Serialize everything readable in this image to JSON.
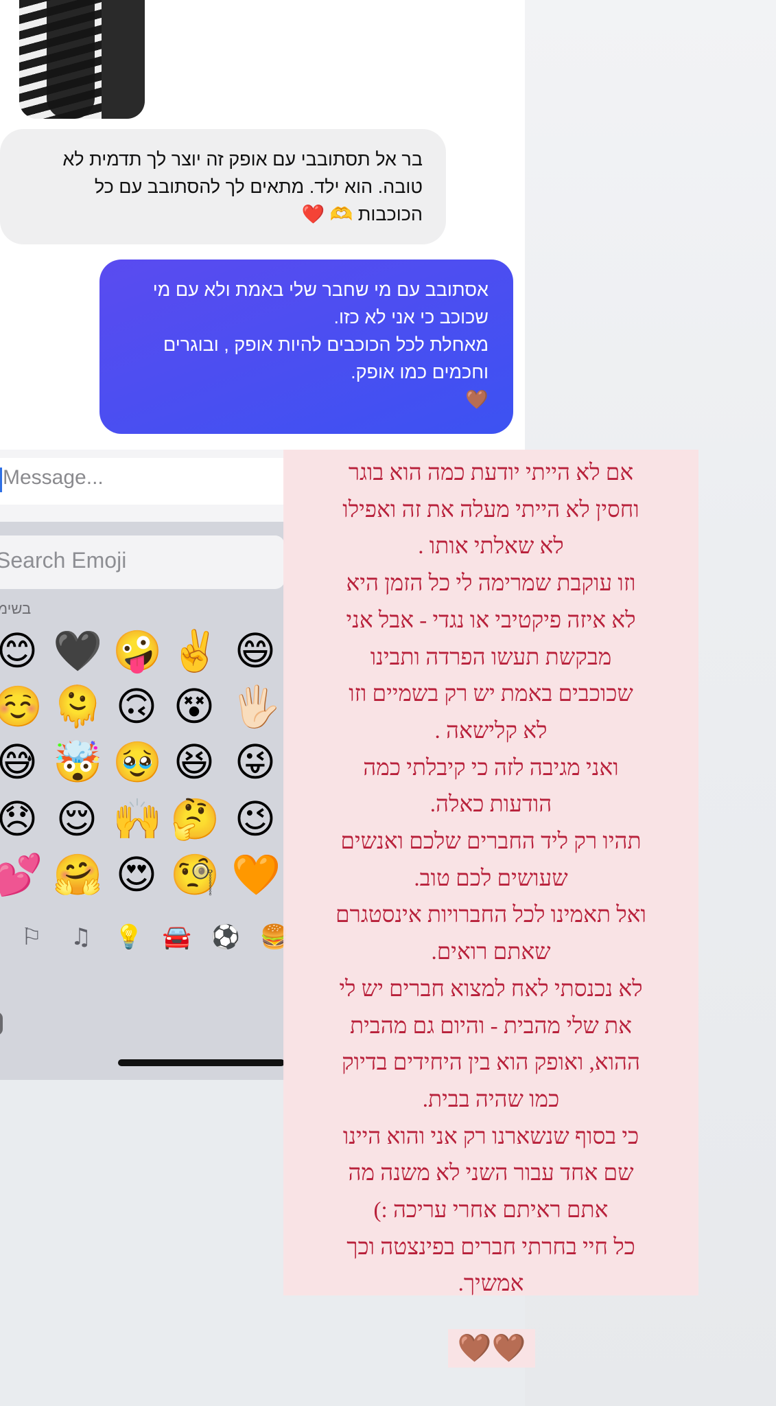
{
  "chat": {
    "incoming": {
      "lines": [
        "בר אל תסתובבי עם אופק זה יוצר לך תדמית לא",
        "טובה. הוא ילד. מתאים לך להסתובב עם כל",
        "הכוכבות 🫶 ❤️"
      ]
    },
    "outgoing": {
      "lines": [
        "אסתובב עם מי שחבר שלי באמת ולא עם מי",
        "שכוכב כי אני לא כזו.",
        "מאחלת לכל הכוכבים להיות אופק , ובוגרים",
        "וחכמים כמו אופק.",
        "🤎"
      ]
    }
  },
  "composer": {
    "placeholder": "Message..."
  },
  "emoji_keyboard": {
    "search_placeholder": "Search Emoji",
    "section_label": "בשימ",
    "rows": [
      [
        "😊",
        "🖤",
        "🤪",
        "✌️",
        "😄"
      ],
      [
        "☺️",
        "🫠",
        "🙃",
        "😵",
        "🖐🏻"
      ],
      [
        "😅",
        "🤯",
        "🥹",
        "😆",
        "😜"
      ],
      [
        "😞",
        "😌",
        "🙌",
        "🤔",
        "😉"
      ],
      [
        "💕",
        "🤗",
        "😍",
        "🧐",
        "🧡"
      ]
    ],
    "categories": [
      "⚐",
      "♫",
      "💡",
      "🚘",
      "⚽",
      "🍔"
    ]
  },
  "story_text": {
    "lines": [
      "אם לא הייתי יודעת כמה הוא בוגר",
      "וחסין לא הייתי מעלה את זה ואפילו",
      "לא שאלתי אותו .",
      "וזו עוקבת שמרימה לי כל הזמן היא",
      "לא איזה פיקטיבי או נגדי - אבל אני",
      "מבקשת תעשו הפרדה ותבינו",
      "שכוכבים באמת יש רק בשמיים וזו",
      "לא קלישאה .",
      "ואני מגיבה לזה כי קיבלתי כמה",
      "הודעות כאלה.",
      "תהיו רק ליד החברים שלכם ואנשים",
      "שעושים לכם טוב.",
      "ואל תאמינו לכל החברויות אינסטגרם",
      "שאתם רואים.",
      "לא נכנסתי לאח למצוא חברים יש לי",
      "את שלי מהבית - והיום גם מהבית",
      "ההוא, ואופק הוא בין היחידים בדיוק",
      "כמו שהיה בבית.",
      "כי בסוף שנשארנו רק אני והוא היינו",
      "שם אחד עבור השני לא משנה מה",
      "אתם ראיתם אחרי עריכה :)",
      "כל חיי בחרתי חברים בפינצטה וכך",
      "אמשיך."
    ],
    "hearts": "🤎🤎"
  }
}
